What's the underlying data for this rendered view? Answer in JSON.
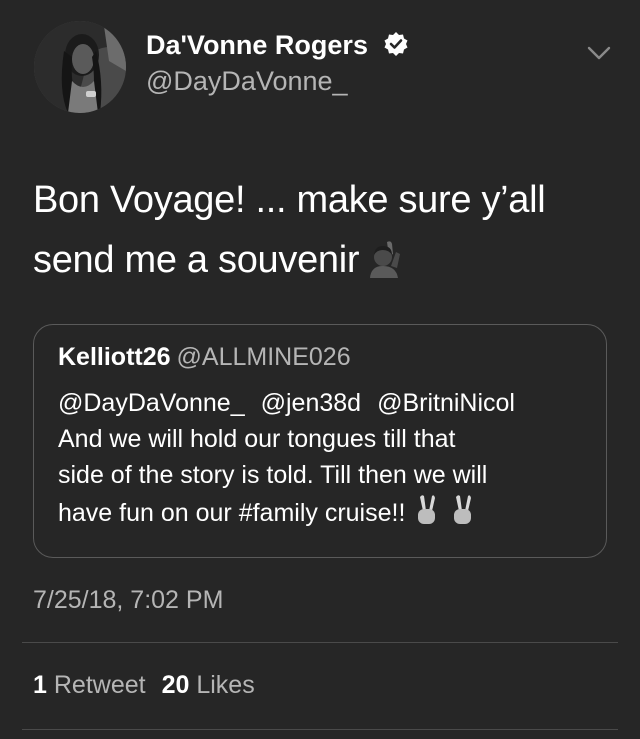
{
  "author": {
    "display_name": "Da'Vonne Rogers",
    "handle": "@DayDaVonne_"
  },
  "tweet": {
    "text_line1": "Bon Voyage! ... make sure y’all",
    "text_line2": "send me a souvenir",
    "emoji": "raising-hand-emoji"
  },
  "quoted": {
    "name": "Kelliott26",
    "handle": "@ALLMINE026",
    "mentions": [
      "@DayDaVonne_",
      "@jen38d",
      "@BritniNicol"
    ],
    "line2": "And we will hold our tongues till that",
    "line3": "side of the story is told. Till then we will",
    "line4": "have fun on our #family cruise!!",
    "emoji": "victory-hand-emoji"
  },
  "timestamp": "7/25/18, 7:02 PM",
  "stats": {
    "retweets": "1",
    "retweets_label": "Retweet",
    "likes": "20",
    "likes_label": "Likes"
  },
  "colors": {
    "background": "#262626",
    "text": "#ffffff",
    "secondary_text": "#b5b5b5",
    "border": "#5a5a5a"
  }
}
